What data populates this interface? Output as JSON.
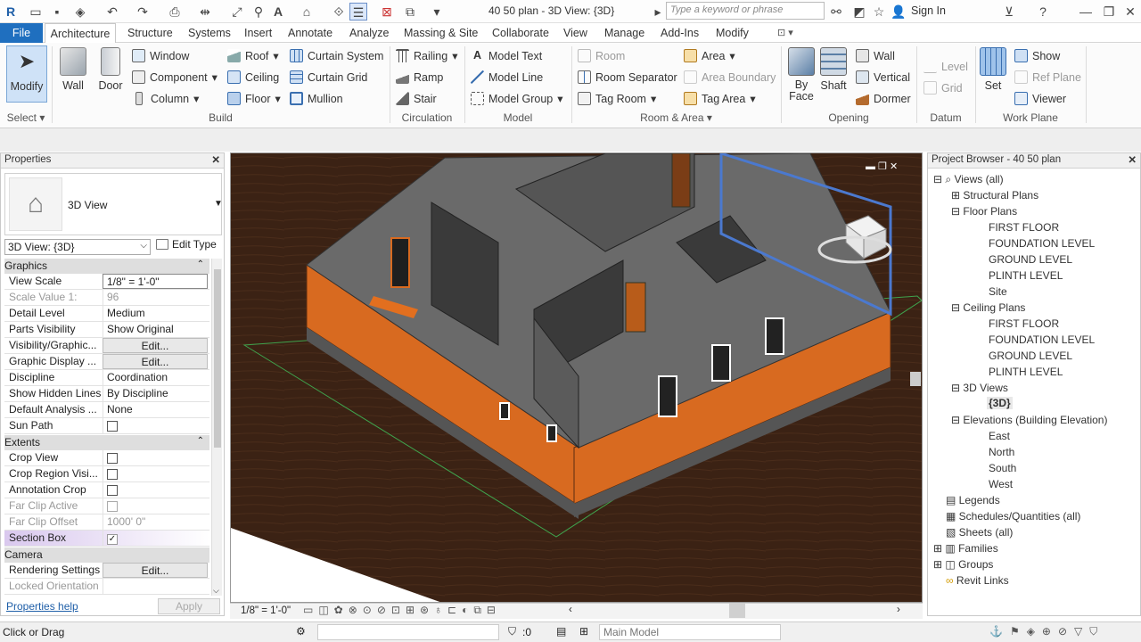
{
  "title_bar": {
    "title": "40 50 plan - 3D View: {3D}",
    "search_placeholder": "Type a keyword or phrase",
    "sign_in": "Sign In"
  },
  "menu": {
    "tabs": [
      "File",
      "Architecture",
      "Structure",
      "Systems",
      "Insert",
      "Annotate",
      "Analyze",
      "Massing & Site",
      "Collaborate",
      "View",
      "Manage",
      "Add-Ins",
      "Modify"
    ],
    "active": "Architecture"
  },
  "ribbon": {
    "select": {
      "modify": "Modify",
      "label": "Select"
    },
    "build": {
      "wall": "Wall",
      "door": "Door",
      "window": "Window",
      "component": "Component",
      "column": "Column",
      "roof": "Roof",
      "ceiling": "Ceiling",
      "floor": "Floor",
      "curtain_system": "Curtain System",
      "curtain_grid": "Curtain Grid",
      "mullion": "Mullion",
      "label": "Build"
    },
    "circulation": {
      "railing": "Railing",
      "ramp": "Ramp",
      "stair": "Stair",
      "label": "Circulation"
    },
    "model": {
      "model_text": "Model Text",
      "model_line": "Model Line",
      "model_group": "Model Group",
      "label": "Model"
    },
    "room_area": {
      "room": "Room",
      "room_separator": "Room Separator",
      "tag_room": "Tag Room",
      "area": "Area",
      "area_boundary": "Area Boundary",
      "tag_area": "Tag Area",
      "label": "Room & Area"
    },
    "opening": {
      "by_face": "By Face",
      "shaft": "Shaft",
      "wall": "Wall",
      "vertical": "Vertical",
      "dormer": "Dormer",
      "label": "Opening"
    },
    "datum": {
      "level": "Level",
      "grid": "Grid",
      "label": "Datum"
    },
    "work_plane": {
      "set": "Set",
      "show": "Show",
      "ref_plane": "Ref Plane",
      "viewer": "Viewer",
      "label": "Work Plane"
    }
  },
  "properties": {
    "header": "Properties",
    "type_name": "3D View",
    "instance": "3D View: {3D}",
    "edit_type": "Edit Type",
    "groups": [
      "Graphics",
      "Extents",
      "Camera"
    ],
    "rows": [
      {
        "k": "View Scale",
        "v": "1/8\" = 1'-0\""
      },
      {
        "k": "Scale Value    1:",
        "v": "96"
      },
      {
        "k": "Detail Level",
        "v": "Medium"
      },
      {
        "k": "Parts Visibility",
        "v": "Show Original"
      },
      {
        "k": "Visibility/Graphic...",
        "v": "Edit..."
      },
      {
        "k": "Graphic Display ...",
        "v": "Edit..."
      },
      {
        "k": "Discipline",
        "v": "Coordination"
      },
      {
        "k": "Show Hidden Lines",
        "v": "By Discipline"
      },
      {
        "k": "Default Analysis ...",
        "v": "None"
      },
      {
        "k": "Sun Path",
        "v": ""
      },
      {
        "k": "Crop View",
        "v": ""
      },
      {
        "k": "Crop Region Visi...",
        "v": ""
      },
      {
        "k": "Annotation Crop",
        "v": ""
      },
      {
        "k": "Far Clip Active",
        "v": ""
      },
      {
        "k": "Far Clip Offset",
        "v": "1000' 0\""
      },
      {
        "k": "Section Box",
        "v": ""
      },
      {
        "k": "Rendering Settings",
        "v": "Edit..."
      },
      {
        "k": "Locked Orientation",
        "v": ""
      }
    ],
    "help": "Properties help",
    "apply": "Apply"
  },
  "view": {
    "scale": "1/8\" = 1'-0\""
  },
  "browser": {
    "header": "Project Browser - 40 50 plan",
    "items": [
      "Views (all)",
      "Structural Plans",
      "Floor Plans",
      "FIRST FLOOR",
      "FOUNDATION LEVEL",
      "GROUND LEVEL",
      "PLINTH LEVEL",
      "Site",
      "Ceiling Plans",
      "FIRST FLOOR",
      "FOUNDATION LEVEL",
      "GROUND LEVEL",
      "PLINTH LEVEL",
      "3D Views",
      "{3D}",
      "Elevations (Building Elevation)",
      "East",
      "North",
      "South",
      "West",
      "Legends",
      "Schedules/Quantities (all)",
      "Sheets (all)",
      "Families",
      "Groups",
      "Revit Links"
    ]
  },
  "status": {
    "left": "Click or Drag",
    "count": ":0",
    "model": "Main Model"
  },
  "colors": {
    "accent": "#1f6fbf",
    "wall_orange": "#d86a20",
    "ground": "#3b2214"
  }
}
